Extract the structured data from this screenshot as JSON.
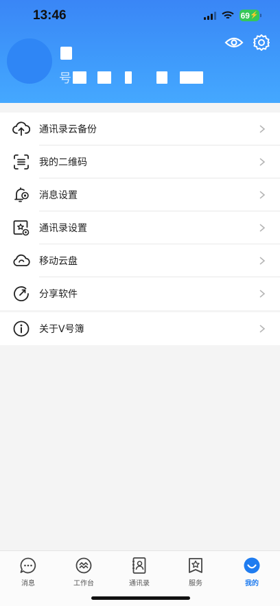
{
  "status_bar": {
    "time": "13:46",
    "battery": "69"
  },
  "header": {
    "sub_prefix": "号"
  },
  "menu": [
    {
      "label": "通讯录云备份",
      "icon": "cloud-upload-icon"
    },
    {
      "label": "我的二维码",
      "icon": "qr-scan-icon"
    },
    {
      "label": "消息设置",
      "icon": "bell-settings-icon"
    },
    {
      "label": "通讯录设置",
      "icon": "contacts-settings-icon"
    },
    {
      "label": "移动云盘",
      "icon": "cloud-icon"
    },
    {
      "label": "分享软件",
      "icon": "share-icon"
    }
  ],
  "about": {
    "label": "关于V号簿",
    "icon": "info-icon"
  },
  "tabs": [
    {
      "label": "消息",
      "icon": "chat-bubble-icon"
    },
    {
      "label": "工作台",
      "icon": "workbench-icon"
    },
    {
      "label": "通讯录",
      "icon": "contacts-book-icon"
    },
    {
      "label": "服务",
      "icon": "star-service-icon"
    },
    {
      "label": "我的",
      "icon": "smile-icon",
      "active": true
    }
  ],
  "colors": {
    "accent": "#1f7cf0",
    "header_top": "#3a86f6",
    "battery": "#35c759"
  }
}
